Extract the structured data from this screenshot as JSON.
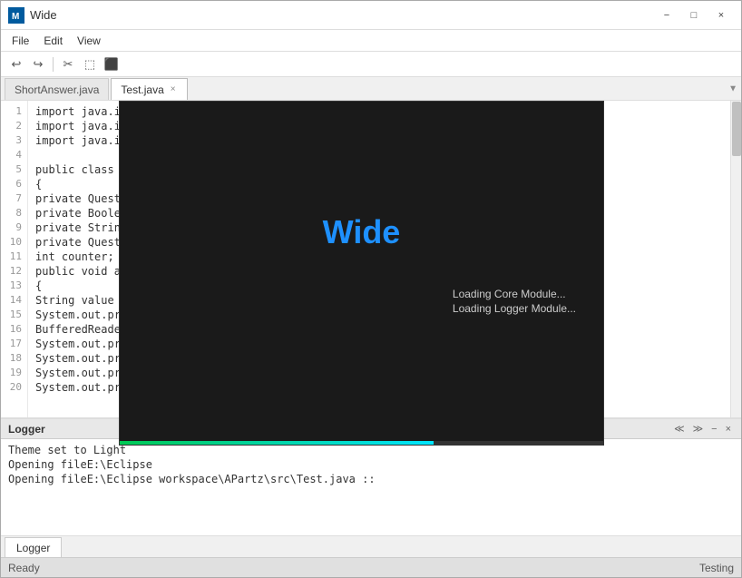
{
  "window": {
    "title": "Wide",
    "icon_label": "vs-icon"
  },
  "title_bar": {
    "title": "Wide",
    "minimize_label": "−",
    "maximize_label": "□",
    "close_label": "×"
  },
  "menu_bar": {
    "items": [
      {
        "label": "File"
      },
      {
        "label": "Edit"
      },
      {
        "label": "View"
      }
    ]
  },
  "toolbar": {
    "undo_label": "↩",
    "redo_label": "↪",
    "cut_label": "✂",
    "copy_label": "⬚",
    "paste_label": "⬛"
  },
  "tabs": [
    {
      "label": "ShortAnswer.java",
      "active": false,
      "closeable": false
    },
    {
      "label": "Test.java",
      "active": true,
      "closeable": true
    }
  ],
  "editor": {
    "lines": [
      {
        "num": "1",
        "code": "import java.io.BufferedReader;"
      },
      {
        "num": "2",
        "code": "import java.io.IOException;"
      },
      {
        "num": "3",
        "code": "import java.io.InputStreamReader;"
      },
      {
        "num": "4",
        "code": ""
      },
      {
        "num": "5",
        "code": "public class Test"
      },
      {
        "num": "6",
        "code": "{"
      },
      {
        "num": "7",
        "code": "    private Question"
      },
      {
        "num": "8",
        "code": "    private Boolean s"
      },
      {
        "num": "9",
        "code": "    private String titl"
      },
      {
        "num": "10",
        "code": "    private Question"
      },
      {
        "num": "11",
        "code": "    int counter;"
      },
      {
        "num": "12",
        "code": "    public void addN"
      },
      {
        "num": "13",
        "code": "    {"
      },
      {
        "num": "14",
        "code": "        String value = '"
      },
      {
        "num": "15",
        "code": "        System.out.pri"
      },
      {
        "num": "16",
        "code": "        BufferedReade"
      },
      {
        "num": "17",
        "code": "        System.out.pri"
      },
      {
        "num": "18",
        "code": "        System.out.pri"
      },
      {
        "num": "19",
        "code": "        System.out.pri"
      },
      {
        "num": "20",
        "code": "        System.out.pri"
      }
    ]
  },
  "splash": {
    "title": "Wide",
    "loading_lines": [
      "Loading Core Module...",
      "Loading Logger Module..."
    ]
  },
  "logger": {
    "title": "Logger",
    "lines": [
      "Theme set to Light",
      "Opening fileE:\\Eclipse",
      "Opening fileE:\\Eclipse workspace\\APartz\\src\\Test.java ::"
    ]
  },
  "bottom_tabs": [
    {
      "label": "Logger",
      "active": true
    }
  ],
  "status_bar": {
    "left": "Ready",
    "right": "Testing"
  }
}
